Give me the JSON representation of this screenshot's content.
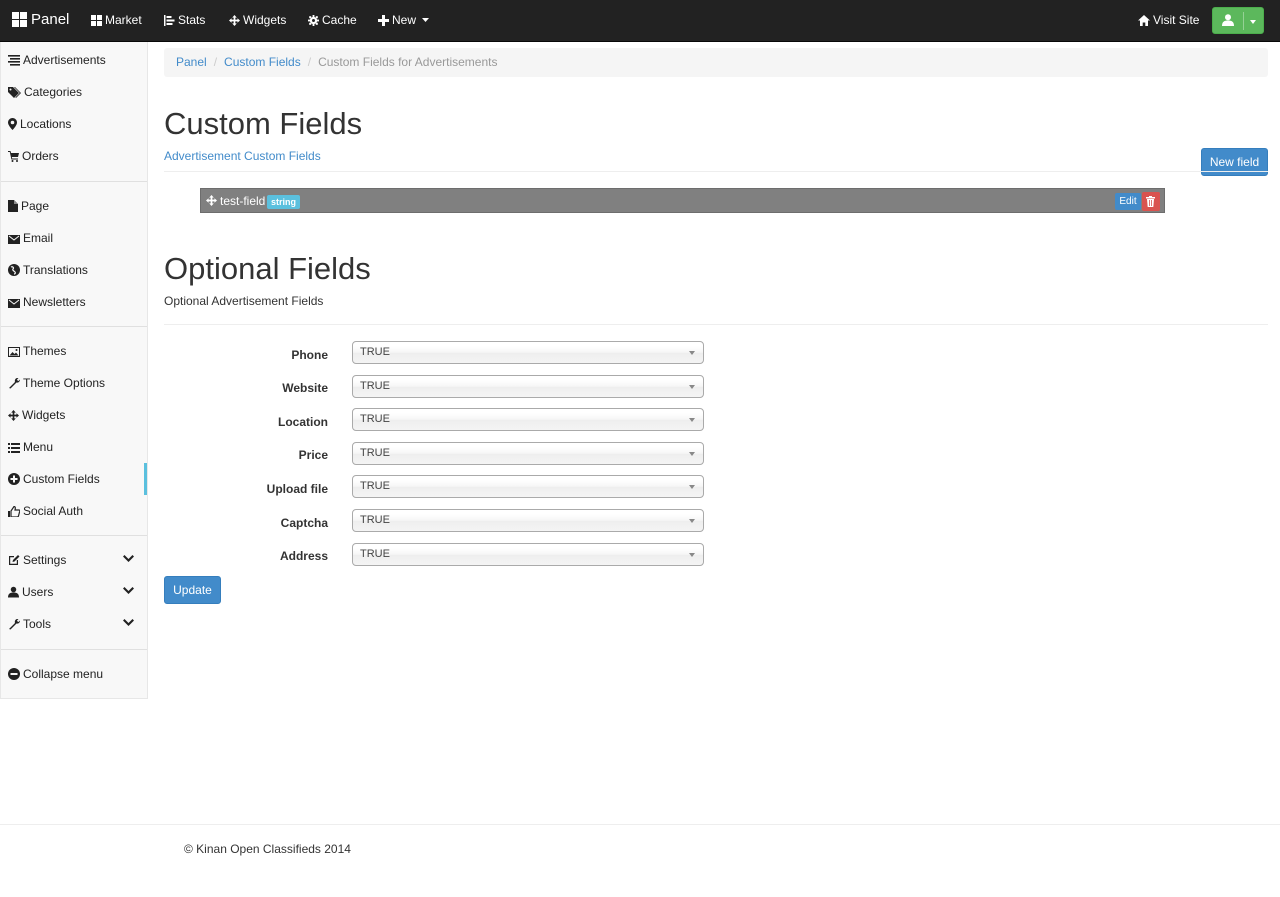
{
  "navbar": {
    "brand": "Panel",
    "items": [
      {
        "label": "Market",
        "icon": "th-large-icon"
      },
      {
        "label": "Stats",
        "icon": "bar-chart-icon"
      },
      {
        "label": "Widgets",
        "icon": "move-icon"
      },
      {
        "label": "Cache",
        "icon": "gear-icon"
      },
      {
        "label": "New",
        "icon": "plus-icon"
      }
    ],
    "visit_site": "Visit Site",
    "user_button_color": "#5cb85c"
  },
  "sidebar": {
    "groups": [
      [
        {
          "label": "Advertisements",
          "icon": "list-icon"
        },
        {
          "label": "Categories",
          "icon": "tags-icon"
        },
        {
          "label": "Locations",
          "icon": "map-marker-icon"
        },
        {
          "label": "Orders",
          "icon": "shopping-cart-icon"
        }
      ],
      [
        {
          "label": "Page",
          "icon": "file-icon"
        },
        {
          "label": "Email",
          "icon": "envelope-icon"
        },
        {
          "label": "Translations",
          "icon": "globe-icon"
        },
        {
          "label": "Newsletters",
          "icon": "envelope-icon"
        }
      ],
      [
        {
          "label": "Themes",
          "icon": "picture-icon"
        },
        {
          "label": "Theme Options",
          "icon": "wrench-icon"
        },
        {
          "label": "Widgets",
          "icon": "move-icon"
        },
        {
          "label": "Menu",
          "icon": "list-alt-icon"
        },
        {
          "label": "Custom Fields",
          "icon": "plus-circle-icon",
          "active": true
        },
        {
          "label": "Social Auth",
          "icon": "thumbs-up-icon"
        }
      ],
      [
        {
          "label": "Settings",
          "icon": "edit-icon",
          "expandable": true
        },
        {
          "label": "Users",
          "icon": "user-icon",
          "expandable": true
        },
        {
          "label": "Tools",
          "icon": "wrench-icon",
          "expandable": true
        }
      ],
      [
        {
          "label": "Collapse menu",
          "icon": "minus-circle-icon"
        }
      ]
    ]
  },
  "breadcrumb": {
    "items": [
      "Panel",
      "Custom Fields"
    ],
    "active": "Custom Fields for Advertisements"
  },
  "custom_fields": {
    "title": "Custom Fields",
    "subtitle_link": "Advertisement Custom Fields",
    "new_field_button": "New field",
    "fields": [
      {
        "name": "test-field",
        "type": "string",
        "edit_label": "Edit"
      }
    ]
  },
  "optional_fields": {
    "title": "Optional Fields",
    "subtitle": "Optional Advertisement Fields",
    "rows": [
      {
        "label": "Phone",
        "value": "TRUE"
      },
      {
        "label": "Website",
        "value": "TRUE"
      },
      {
        "label": "Location",
        "value": "TRUE"
      },
      {
        "label": "Price",
        "value": "TRUE"
      },
      {
        "label": "Upload file",
        "value": "TRUE"
      },
      {
        "label": "Captcha",
        "value": "TRUE"
      },
      {
        "label": "Address",
        "value": "TRUE"
      }
    ],
    "update_button": "Update"
  },
  "footer": {
    "text": "© Kinan Open Classifieds 2014"
  },
  "colors": {
    "navbar_bg": "#222222",
    "primary": "#428bca",
    "info": "#5bc0de",
    "danger": "#d9534f",
    "success": "#5cb85c"
  }
}
